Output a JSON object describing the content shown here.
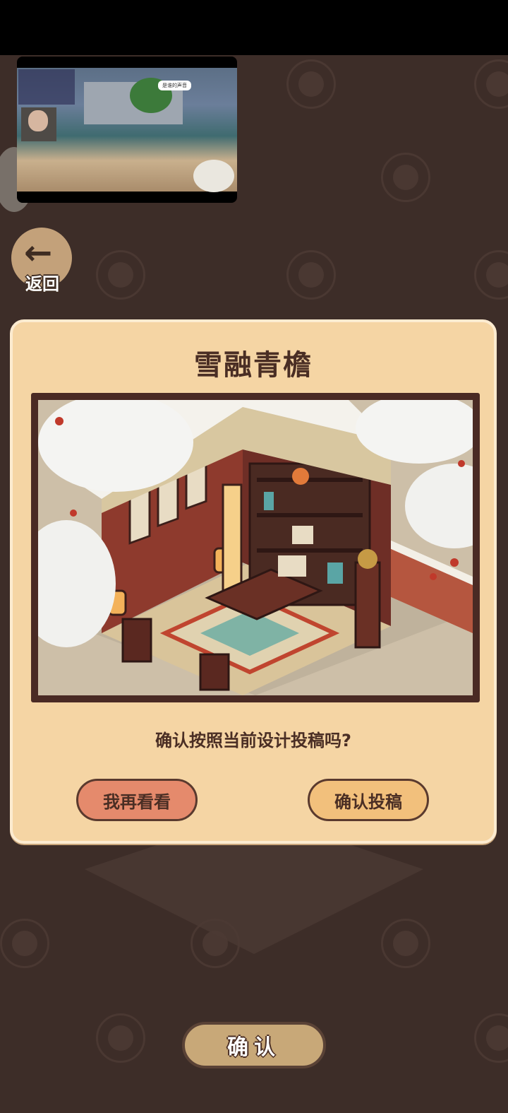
{
  "overlay": {
    "pip_bubble": "是谁的声音",
    "colors": {
      "stream_bg": "#000000"
    }
  },
  "nav": {
    "back_label": "返回",
    "back_icon": "arrow-left-icon"
  },
  "dialog": {
    "title": "雪融青檐",
    "question": "确认按照当前设计投稿吗?",
    "cancel_label": "我再看看",
    "submit_label": "确认投稿",
    "colors": {
      "panel": "#f5d5a4",
      "cancel": "#e58a6c",
      "submit": "#f2c07c",
      "text": "#4a2e24"
    }
  },
  "footer": {
    "confirm_label": "确认"
  }
}
